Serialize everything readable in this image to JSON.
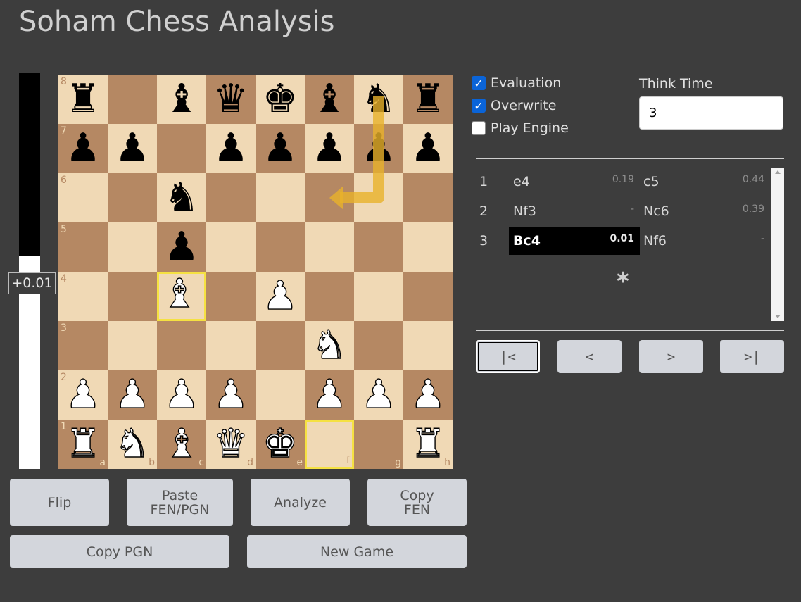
{
  "app": {
    "title": "Soham Chess Analysis"
  },
  "eval": {
    "label": "+0.01",
    "white_share": 0.54
  },
  "board": {
    "ranks": [
      "8",
      "7",
      "6",
      "5",
      "4",
      "3",
      "2",
      "1"
    ],
    "files": [
      "a",
      "b",
      "c",
      "d",
      "e",
      "f",
      "g",
      "h"
    ],
    "light_color": "#f0d9b5",
    "dark_color": "#b58863",
    "highlight_color": "#f5e142",
    "highlighted_squares": [
      "c4",
      "f1"
    ],
    "pieces": {
      "a8": "bR",
      "c8": "bB",
      "d8": "bQ",
      "e8": "bK",
      "f8": "bB",
      "g8": "bN",
      "h8": "bR",
      "a7": "bP",
      "b7": "bP",
      "d7": "bP",
      "e7": "bP",
      "f7": "bP",
      "g7": "bP",
      "h7": "bP",
      "c6": "bN",
      "c5": "bP",
      "c4": "wB",
      "e4": "wP",
      "f3": "wN",
      "a2": "wP",
      "b2": "wP",
      "c2": "wP",
      "d2": "wP",
      "f2": "wP",
      "g2": "wP",
      "h2": "wP",
      "a1": "wR",
      "b1": "wN",
      "c1": "wB",
      "d1": "wQ",
      "e1": "wK",
      "h1": "wR"
    },
    "arrow": {
      "from": "g8",
      "to": "f6",
      "color": "#e8b12a"
    }
  },
  "buttons": {
    "flip": "Flip",
    "paste_line1": "Paste",
    "paste_line2": "FEN/PGN",
    "analyze": "Analyze",
    "copy_fen_line1": "Copy",
    "copy_fen_line2": "FEN",
    "copy_pgn": "Copy PGN",
    "new_game": "New Game"
  },
  "options": {
    "evaluation": {
      "label": "Evaluation",
      "checked": true
    },
    "overwrite": {
      "label": "Overwrite",
      "checked": true
    },
    "play_engine": {
      "label": "Play Engine",
      "checked": false
    },
    "think_time_label": "Think Time",
    "think_time_value": "3"
  },
  "moves": [
    {
      "num": "1",
      "white": "e4",
      "white_eval": "0.19",
      "black": "c5",
      "black_eval": "0.44"
    },
    {
      "num": "2",
      "white": "Nf3",
      "white_eval": "-",
      "black": "Nc6",
      "black_eval": "0.39"
    },
    {
      "num": "3",
      "white": "Bc4",
      "white_eval": "0.01",
      "black": "Nf6",
      "black_eval": "-"
    }
  ],
  "active_move": {
    "row": 2,
    "side": "white"
  },
  "result": "*",
  "nav": {
    "first": "|<",
    "prev": "<",
    "next": ">",
    "last": ">|"
  }
}
